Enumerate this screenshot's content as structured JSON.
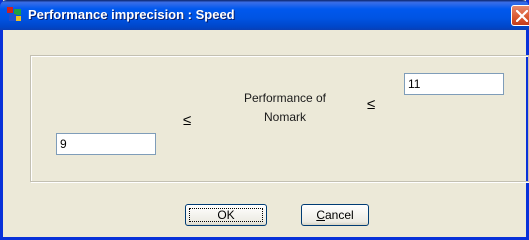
{
  "window": {
    "title": "Performance imprecision : Speed"
  },
  "form": {
    "upper_value": "11",
    "lower_value": "9",
    "leq_symbol": "≤",
    "center_label_line1": "Performance of",
    "center_label_line2": "Nomark"
  },
  "buttons": {
    "ok_label": "OK",
    "cancel_mnemonic": "C",
    "cancel_rest": "ancel"
  },
  "icons": {
    "app_icon": "app-icon",
    "close_icon": "close-icon"
  },
  "colors": {
    "titlebar": "#0054e3",
    "window_bg": "#ece9d8",
    "close_button": "#d9582f"
  }
}
